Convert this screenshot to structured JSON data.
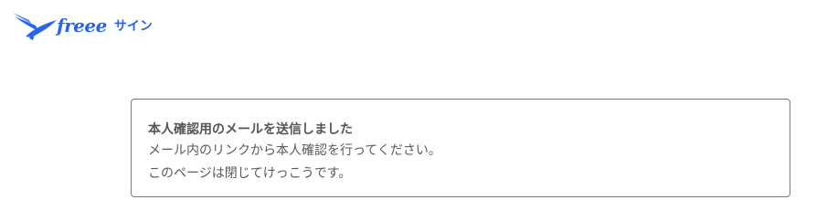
{
  "header": {
    "logo_icon": "freee-bird-logo-icon",
    "brand_name": "freee",
    "product_name": "サイン",
    "brand_color": "#2864f0"
  },
  "message": {
    "title": "本人確認用のメールを送信しました",
    "line1": "メール内のリンクから本人確認を行ってください。",
    "line2": "このページは閉じてけっこうです。",
    "border_color": "#7a7a7a",
    "text_color": "#5a5a5a"
  }
}
